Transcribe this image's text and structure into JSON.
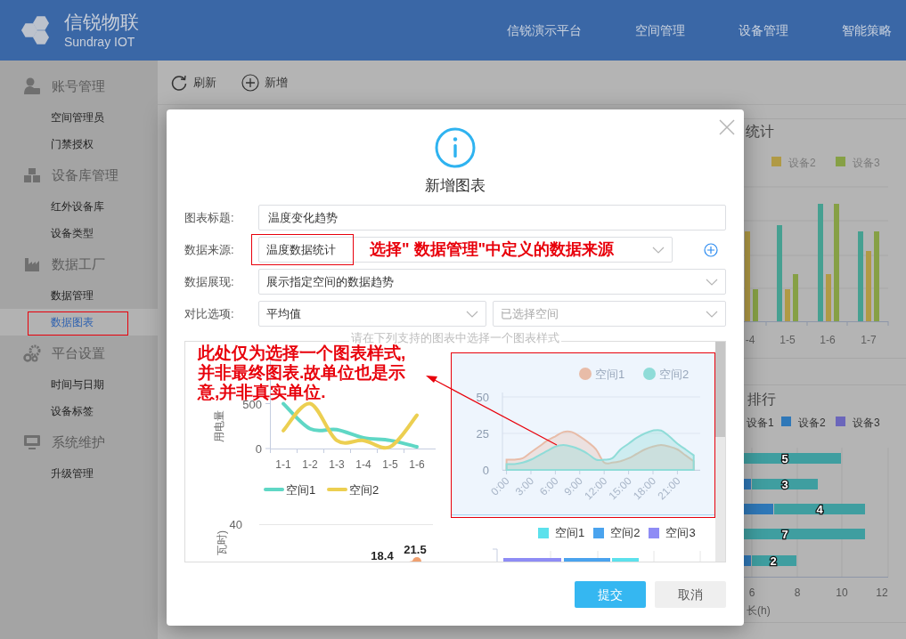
{
  "header": {
    "brand": "信锐物联",
    "brand_sub": "Sundray IOT",
    "nav": [
      "信锐演示平台",
      "空间管理",
      "设备管理",
      "智能策略"
    ]
  },
  "sidebar": {
    "groups": [
      {
        "title": "账号管理",
        "items": [
          {
            "label": "空间管理员",
            "selected": false,
            "annotated": false
          },
          {
            "label": "门禁授权",
            "selected": false,
            "annotated": false
          }
        ]
      },
      {
        "title": "设备库管理",
        "items": [
          {
            "label": "红外设备库",
            "selected": false,
            "annotated": false
          },
          {
            "label": "设备类型",
            "selected": false,
            "annotated": false
          }
        ]
      },
      {
        "title": "数据工厂",
        "items": [
          {
            "label": "数据管理",
            "selected": false,
            "annotated": false
          },
          {
            "label": "数据图表",
            "selected": true,
            "annotated": true
          }
        ]
      },
      {
        "title": "平台设置",
        "items": [
          {
            "label": "时间与日期",
            "selected": false,
            "annotated": false
          },
          {
            "label": "设备标签",
            "selected": false,
            "annotated": false
          }
        ]
      },
      {
        "title": "系统维护",
        "items": [
          {
            "label": "升级管理",
            "selected": false,
            "annotated": false
          }
        ]
      }
    ]
  },
  "toolbar": [
    "刷新",
    "新增"
  ],
  "background": {
    "device_stats": {
      "title": "统计",
      "legend": [
        {
          "label": "设备2",
          "color": "#b09a45"
        },
        {
          "label": "设备3",
          "color": "#86a045"
        }
      ],
      "categories": [
        "-4",
        "1-5",
        "1-6",
        "1-7"
      ]
    },
    "ranking": {
      "title": "排行",
      "legend": [
        {
          "label": "设备1"
        },
        {
          "label": "设备2",
          "color": "#2f78b8"
        },
        {
          "label": "设备3",
          "color": "#6b66bb"
        }
      ],
      "bar_labels": [
        "5",
        "3",
        "4",
        "7",
        "2"
      ],
      "axis_ticks": [
        "6",
        "8",
        "10",
        "12"
      ],
      "axis_title": "长(h)"
    }
  },
  "dialog": {
    "title": "新增图表",
    "fields": [
      {
        "label": "图表标题:",
        "kind": "text",
        "value": "温度变化趋势",
        "annotated": false
      },
      {
        "label": "数据来源:",
        "kind": "select",
        "value": "温度数据统计",
        "annotated": true
      },
      {
        "label": "数据展现:",
        "kind": "select",
        "value": "展示指定空间的数据趋势",
        "annotated": false
      },
      {
        "label": "对比选项:",
        "kind": "select_pair",
        "value": "平均值",
        "placeholder": "已选择空间",
        "annotated": false
      }
    ],
    "chart_picker": {
      "legend": "请在下列支持的图表中选择一个图表样式",
      "previews": [
        {
          "selected": false,
          "chart_data": {
            "type": "line",
            "ylabel": "用电量",
            "categories": [
              "1-1",
              "1-2",
              "1-3",
              "1-4",
              "1-5",
              "1-6"
            ],
            "ylim": [
              0,
              1000
            ],
            "yticks": [
              0,
              500
            ],
            "legend": "bottom",
            "series": [
              {
                "name": "空间1",
                "color": "#5fd7c5",
                "values": [
                  500,
                  220,
                  210,
                  120,
                  90,
                  20
                ]
              },
              {
                "name": "空间2",
                "color": "#eccf51",
                "values": [
                  200,
                  500,
                  90,
                  90,
                  20,
                  370
                ]
              }
            ]
          }
        },
        {
          "selected": true,
          "chart_data": {
            "type": "area",
            "x": [
              0,
              1,
              2,
              3,
              4,
              5,
              6,
              7,
              8,
              9,
              10,
              11,
              12,
              13,
              14,
              15,
              16,
              17,
              18,
              19,
              20,
              21,
              22,
              23
            ],
            "xlim": [
              -0.5,
              23.8
            ],
            "xticks": [
              {
                "value": 0,
                "label": "0:00"
              },
              {
                "value": 3,
                "label": "3:00"
              },
              {
                "value": 6,
                "label": "6:00"
              },
              {
                "value": 9,
                "label": "9:00"
              },
              {
                "value": 12,
                "label": "12:00"
              },
              {
                "value": 15,
                "label": "15:00"
              },
              {
                "value": 18,
                "label": "18:00"
              },
              {
                "value": 21,
                "label": "21:00"
              }
            ],
            "ylim": [
              0,
              50
            ],
            "yticks": [
              0,
              25,
              50
            ],
            "legend": "top",
            "series": [
              {
                "name": "空间1",
                "color": "#e8bca8",
                "values": [
                  7,
                  7,
                  8,
                  12,
                  16,
                  20,
                  23,
                  26,
                  26,
                  23,
                  19,
                  14,
                  5,
                  5,
                  6,
                  8,
                  11,
                  14,
                  16,
                  17,
                  16,
                  14,
                  10,
                  6
                ]
              },
              {
                "name": "空间2",
                "color": "#8fdcd8",
                "values": [
                  4,
                  4,
                  5,
                  7,
                  10,
                  13,
                  16,
                  17,
                  16,
                  14,
                  11,
                  7,
                  7,
                  8,
                  14,
                  18,
                  22,
                  25,
                  27,
                  27,
                  23,
                  18,
                  14,
                  10
                ]
              }
            ]
          }
        },
        {
          "kind": "line_partial",
          "selected": false,
          "y_tick": "40",
          "ylabel": "瓦时)",
          "value_labels": [
            "18.4",
            "21.5"
          ]
        },
        {
          "kind": "bar_partial",
          "selected": false,
          "legend": [
            {
              "label": "空间1",
              "color": "#5ce1ec"
            },
            {
              "label": "空间2",
              "color": "#4aa3ee"
            },
            {
              "label": "空间3",
              "color": "#8e8cf5"
            }
          ]
        }
      ]
    },
    "buttons": [
      {
        "label": "提交",
        "kind": "primary"
      },
      {
        "label": "取消",
        "kind": "default"
      }
    ]
  },
  "annotations": {
    "source_hint": "选择\" 数据管理\"中定义的数据来源",
    "chart_note": [
      "此处仅为选择一个图表样式,",
      "并非最终图表.故单位也是示",
      "意,并非真实单位."
    ]
  }
}
